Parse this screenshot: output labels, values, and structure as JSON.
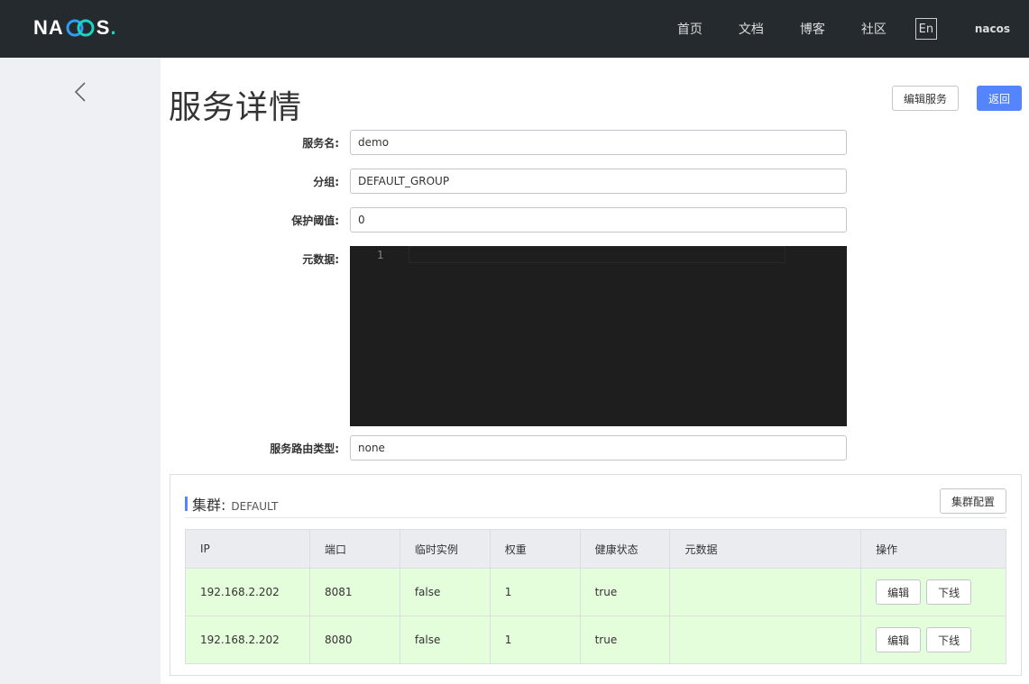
{
  "header": {
    "logo": {
      "left": "NA",
      "right": "S",
      "dot": "."
    },
    "nav": [
      {
        "label": "首页"
      },
      {
        "label": "文档"
      },
      {
        "label": "博客"
      },
      {
        "label": "社区"
      }
    ],
    "lang": "En",
    "user": "nacos"
  },
  "sidebar": {
    "back_icon": "chevron-left-icon"
  },
  "page": {
    "title": "服务详情",
    "edit_service_label": "编辑服务",
    "back_label": "返回"
  },
  "form": {
    "service_name": {
      "label": "服务名:",
      "value": "demo"
    },
    "group": {
      "label": "分组:",
      "value": "DEFAULT_GROUP"
    },
    "protect_threshold": {
      "label": "保护阈值:",
      "value": "0"
    },
    "metadata": {
      "label": "元数据:",
      "line_number": "1"
    },
    "selector_type": {
      "label": "服务路由类型:",
      "value": "none"
    }
  },
  "cluster": {
    "label": "集群:",
    "name": "DEFAULT",
    "config_label": "集群配置",
    "columns": [
      "IP",
      "端口",
      "临时实例",
      "权重",
      "健康状态",
      "元数据",
      "操作"
    ],
    "rows": [
      {
        "ip": "192.168.2.202",
        "port": "8081",
        "ephemeral": "false",
        "weight": "1",
        "healthy": "true",
        "metadata": "",
        "edit": "编辑",
        "offline": "下线"
      },
      {
        "ip": "192.168.2.202",
        "port": "8080",
        "ephemeral": "false",
        "weight": "1",
        "healthy": "true",
        "metadata": "",
        "edit": "编辑",
        "offline": "下线"
      }
    ]
  },
  "colors": {
    "header_bg": "#252a2f",
    "sidebar_bg": "#eef0f3",
    "primary": "#5584ff",
    "row_bg": "#e4fdda",
    "logo_accent": "#17d4c4"
  }
}
